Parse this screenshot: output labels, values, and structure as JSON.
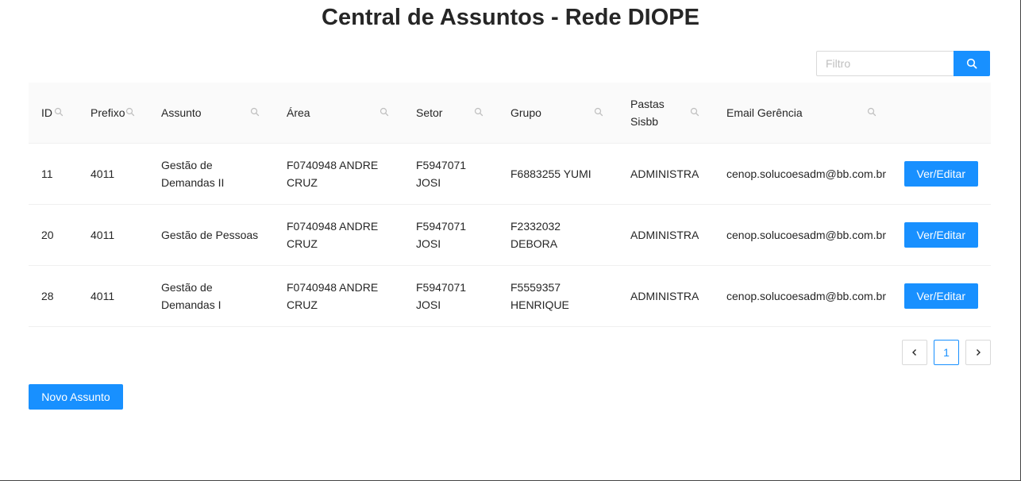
{
  "page": {
    "title": "Central de Assuntos - Rede DIOPE"
  },
  "search": {
    "placeholder": "Filtro",
    "value": ""
  },
  "table": {
    "columns": [
      "ID",
      "Prefixo",
      "Assunto",
      "Área",
      "Setor",
      "Grupo",
      "Pastas Sisbb",
      "Email Gerência",
      ""
    ],
    "rows": [
      {
        "id": "11",
        "prefixo": "4011",
        "assunto": "Gestão de Demandas II",
        "area": "F0740948 ANDRE CRUZ",
        "setor": "F5947071 JOSI",
        "grupo": "F6883255 YUMI",
        "pastas": "ADMINISTRA",
        "email": "cenop.solucoesadm@bb.com.br",
        "action": "Ver/Editar"
      },
      {
        "id": "20",
        "prefixo": "4011",
        "assunto": "Gestão de Pessoas",
        "area": "F0740948 ANDRE CRUZ",
        "setor": "F5947071 JOSI",
        "grupo": "F2332032 DEBORA",
        "pastas": "ADMINISTRA",
        "email": "cenop.solucoesadm@bb.com.br",
        "action": "Ver/Editar"
      },
      {
        "id": "28",
        "prefixo": "4011",
        "assunto": "Gestão de Demandas I",
        "area": "F0740948 ANDRE CRUZ",
        "setor": "F5947071 JOSI",
        "grupo": "F5559357 HENRIQUE",
        "pastas": "ADMINISTRA",
        "email": "cenop.solucoesadm@bb.com.br",
        "action": "Ver/Editar"
      }
    ]
  },
  "pagination": {
    "current": "1"
  },
  "footer": {
    "new_label": "Novo Assunto"
  },
  "icons": {
    "search": "search-icon",
    "filter": "column-search-icon",
    "prev": "chevron-left-icon",
    "next": "chevron-right-icon"
  },
  "colors": {
    "primary": "#1890ff",
    "header_bg": "#fafafa"
  }
}
